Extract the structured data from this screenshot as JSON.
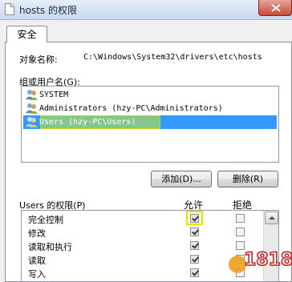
{
  "window": {
    "title": "hosts 的权限"
  },
  "tabs": [
    {
      "label": "安全"
    }
  ],
  "object": {
    "label": "对象名称:",
    "path": "C:\\Windows\\System32\\drivers\\etc\\hosts"
  },
  "groups": {
    "label": "组或用户名(G):",
    "items": [
      {
        "name": "SYSTEM",
        "icon": "user-group-icon",
        "selected": false
      },
      {
        "name": "Administrators (hzy-PC\\Administrators)",
        "icon": "user-group-icon",
        "selected": false
      },
      {
        "name": "Users (hzy-PC\\Users)",
        "icon": "user-group-icon",
        "selected": true
      }
    ]
  },
  "buttons": {
    "add": "添加(D)...",
    "remove": "删除(R)"
  },
  "permissions": {
    "header": "Users 的权限(P)",
    "allow_label": "允许",
    "deny_label": "拒绝",
    "rows": [
      {
        "name": "完全控制",
        "allow": true,
        "deny": false
      },
      {
        "name": "修改",
        "allow": true,
        "deny": false
      },
      {
        "name": "读取和执行",
        "allow": true,
        "deny": false
      },
      {
        "name": "读取",
        "allow": true,
        "deny": false
      },
      {
        "name": "写入",
        "allow": true,
        "deny": false
      }
    ]
  },
  "watermark": {
    "text": "1818"
  },
  "colors": {
    "selection": "#3399ff",
    "highlight": "#e8e400",
    "close": "#c64a36"
  }
}
